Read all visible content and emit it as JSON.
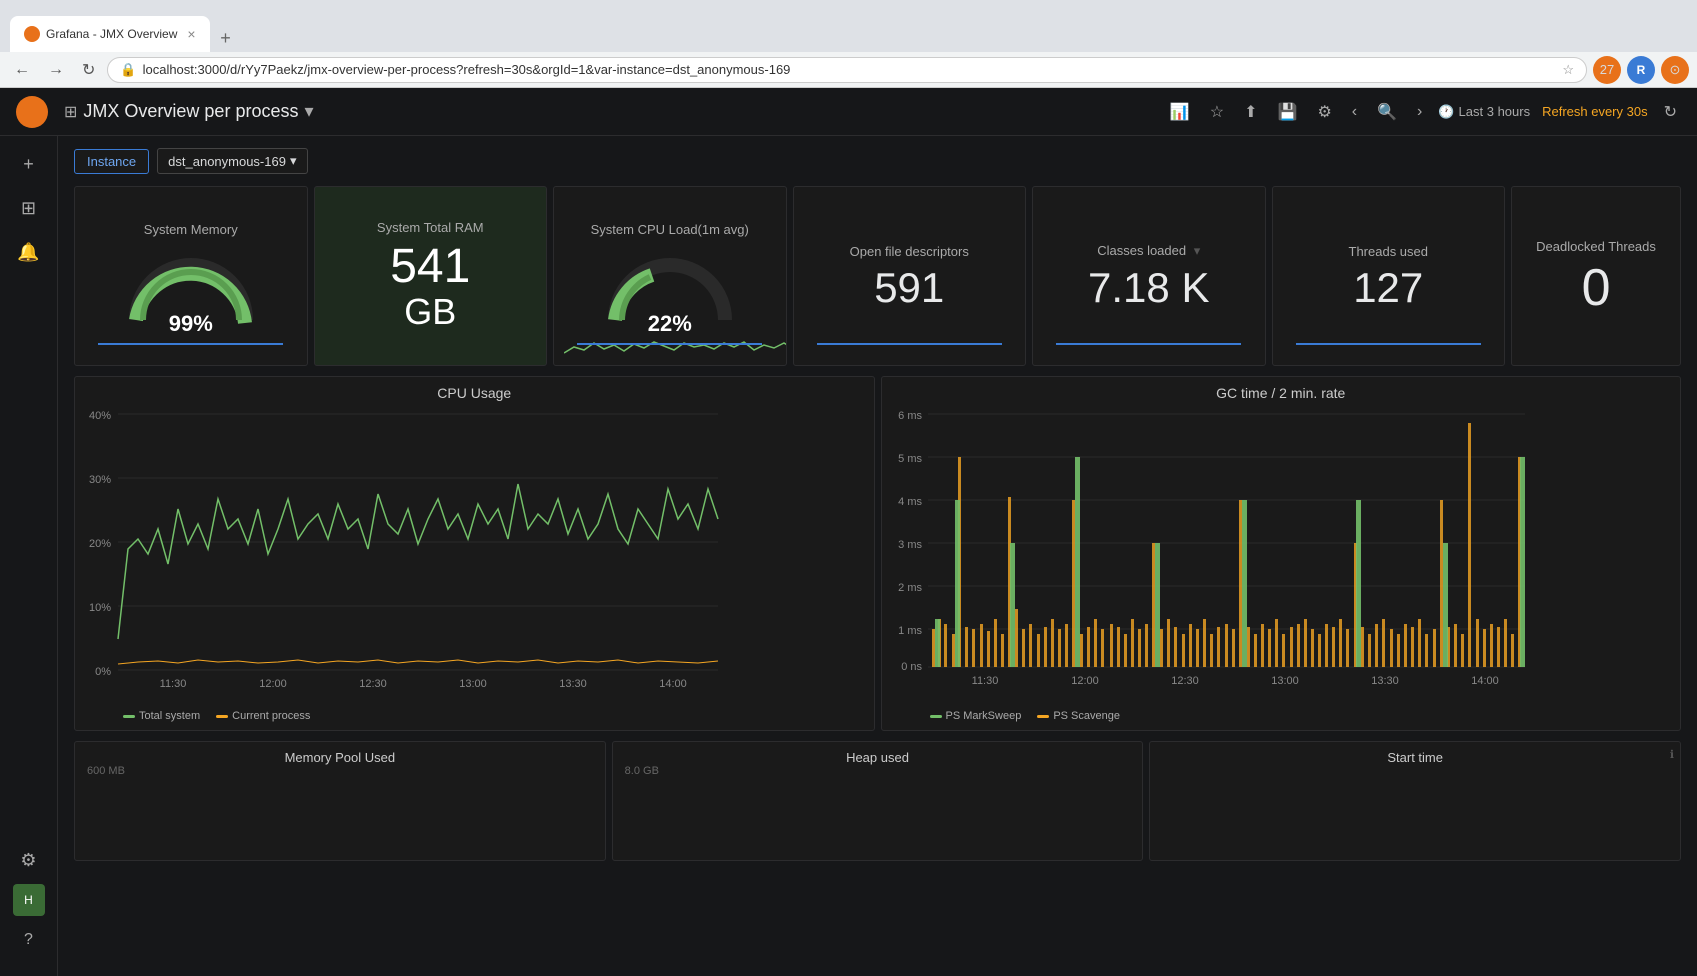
{
  "browser": {
    "tab_title": "Grafana - JMX Overview",
    "tab_icon": "🔥",
    "url": "localhost:3000/d/rYy7Paekz/jmx-overview-per-process?refresh=30s&orgId=1&var-instance=dst_anonymous-169"
  },
  "header": {
    "logo": "🔥",
    "title": "JMX Overview per process",
    "time_range": "Last 3 hours",
    "refresh": "Refresh every 30s"
  },
  "instance": {
    "label": "Instance",
    "value": "dst_anonymous-169"
  },
  "stats": {
    "system_memory": {
      "title": "System Memory",
      "value": "99%"
    },
    "system_total_ram": {
      "title": "System Total RAM",
      "value": "541",
      "unit": "GB"
    },
    "system_cpu_load": {
      "title": "System CPU Load(1m avg)",
      "value": "22%"
    },
    "open_file_descriptors": {
      "title": "Open file descriptors",
      "value": "591"
    },
    "classes_loaded": {
      "title": "Classes loaded",
      "value": "7.18 K"
    },
    "threads_used": {
      "title": "Threads used",
      "value": "127"
    },
    "deadlocked_threads": {
      "title": "Deadlocked Threads",
      "value": "0"
    }
  },
  "charts": {
    "cpu_usage": {
      "title": "CPU Usage",
      "legend": [
        {
          "label": "Total system",
          "color": "#73BF69"
        },
        {
          "label": "Current process",
          "color": "#F5A623"
        }
      ],
      "y_labels": [
        "40%",
        "30%",
        "20%",
        "10%",
        "0%"
      ],
      "x_labels": [
        "11:30",
        "12:00",
        "12:30",
        "13:00",
        "13:30",
        "14:00"
      ]
    },
    "gc_time": {
      "title": "GC time / 2 min. rate",
      "legend": [
        {
          "label": "PS MarkSweep",
          "color": "#73BF69"
        },
        {
          "label": "PS Scavenge",
          "color": "#F5A623"
        }
      ],
      "y_labels": [
        "6 ms",
        "5 ms",
        "4 ms",
        "3 ms",
        "2 ms",
        "1 ms",
        "0 ns"
      ],
      "x_labels": [
        "11:30",
        "12:00",
        "12:30",
        "13:00",
        "13:30",
        "14:00"
      ]
    }
  },
  "bottom_panels": {
    "memory_pool": {
      "title": "Memory Pool Used",
      "sub": "600 MB"
    },
    "heap_used": {
      "title": "Heap used",
      "sub": "8.0 GB"
    },
    "start_time": {
      "title": "Start time"
    }
  },
  "sidebar": {
    "items": [
      {
        "icon": "+",
        "name": "add"
      },
      {
        "icon": "⊞",
        "name": "dashboards"
      },
      {
        "icon": "🔔",
        "name": "alerts"
      },
      {
        "icon": "⚙",
        "name": "settings"
      }
    ]
  }
}
